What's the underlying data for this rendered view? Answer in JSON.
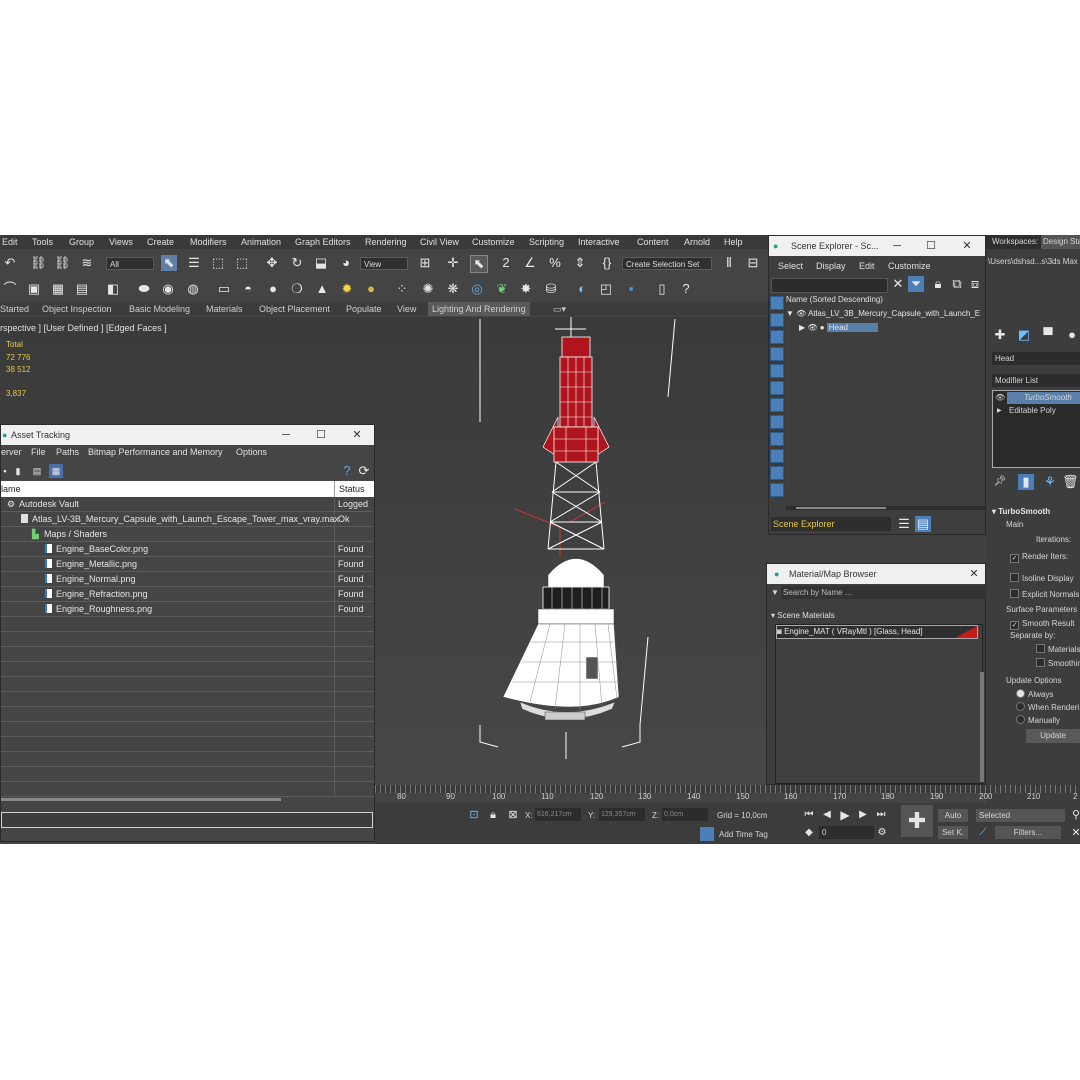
{
  "menu": [
    "Edit",
    "Tools",
    "Group",
    "Views",
    "Create",
    "Modifiers",
    "Animation",
    "Graph Editors",
    "Rendering",
    "Civil View",
    "Customize",
    "Scripting",
    "Interactive",
    "Content",
    "Arnold",
    "Help"
  ],
  "toolbar": {
    "filter_value": "All",
    "view_value": "View",
    "selection_set": "Create Selection Set"
  },
  "ribbon": [
    "Started",
    "Object Inspection",
    "Basic Modeling",
    "Materials",
    "Object Placement",
    "Populate",
    "View",
    "Lighting And Rendering"
  ],
  "viewport": {
    "label": "rspective ] [User Defined ] [Edged Faces ]",
    "stats": {
      "total": "Total",
      "v1": "72 776",
      "v2": "38 512",
      "fps": "3,837"
    }
  },
  "asset_tracking": {
    "title": "Asset Tracking",
    "menu": [
      "erver",
      "File",
      "Paths",
      "Bitmap Performance and Memory",
      "Options"
    ],
    "columns": {
      "name": "lame",
      "status": "Status"
    },
    "rows": [
      {
        "name": "Autodesk Vault",
        "status": "Logged"
      },
      {
        "name": "Atlas_LV-3B_Mercury_Capsule_with_Launch_Escape_Tower_max_vray.max",
        "status": "Ok"
      },
      {
        "name": "Maps / Shaders",
        "status": ""
      },
      {
        "name": "Engine_BaseColor.png",
        "status": "Found"
      },
      {
        "name": "Engine_Metallic.png",
        "status": "Found"
      },
      {
        "name": "Engine_Normal.png",
        "status": "Found"
      },
      {
        "name": "Engine_Refraction.png",
        "status": "Found"
      },
      {
        "name": "Engine_Roughness.png",
        "status": "Found"
      }
    ]
  },
  "scene_explorer": {
    "title": "Scene Explorer - Sc...",
    "menu": [
      "Select",
      "Display",
      "Edit",
      "Customize"
    ],
    "column": "Name (Sorted Descending)",
    "root": "Atlas_LV_3B_Mercury_Capsule_with_Launch_E",
    "child": "Head",
    "footer": "Scene Explorer"
  },
  "material_browser": {
    "title": "Material/Map Browser",
    "search_placeholder": "Search by Name ...",
    "section": "Scene Materials",
    "item": "Engine_MAT  ( VRayMtl )  [Glass, Head]"
  },
  "workspaces": {
    "label": "Workspaces:",
    "value": "Design Sta",
    "path": "\\Users\\dshsd...s\\3ds Max"
  },
  "command_panel": {
    "object_name": "Head",
    "modifier_list": "Modifier List",
    "stack": [
      "TurboSmooth",
      "Editable Poly"
    ],
    "rollout": "TurboSmooth",
    "main": "Main",
    "iterations": "Iterations:",
    "render_iters": "Render Iters:",
    "isoline": "Isoline Display",
    "explicit": "Explicit Normals",
    "surface": "Surface Parameters",
    "smooth_result": "Smooth Result",
    "separate": "Separate by:",
    "materials": "Materials",
    "smoothing": "Smoothin",
    "update_options": "Update Options",
    "always": "Always",
    "when_rendering": "When Renderi",
    "manually": "Manually",
    "update_btn": "Update"
  },
  "timeline": {
    "ticks": [
      "80",
      "90",
      "100",
      "110",
      "120",
      "130",
      "140",
      "150",
      "160",
      "170",
      "180",
      "190",
      "200",
      "210",
      "2"
    ]
  },
  "status": {
    "x_label": "X:",
    "x": "616,217cm",
    "y_label": "Y:",
    "y": "129,357cm",
    "z_label": "Z:",
    "z": "0,0cm",
    "grid": "Grid = 10,0cm",
    "add_time_tag": "Add Time Tag",
    "frame": "0",
    "auto": "Auto",
    "selected": "Selected",
    "setk": "Set K.",
    "filters": "Filters..."
  }
}
